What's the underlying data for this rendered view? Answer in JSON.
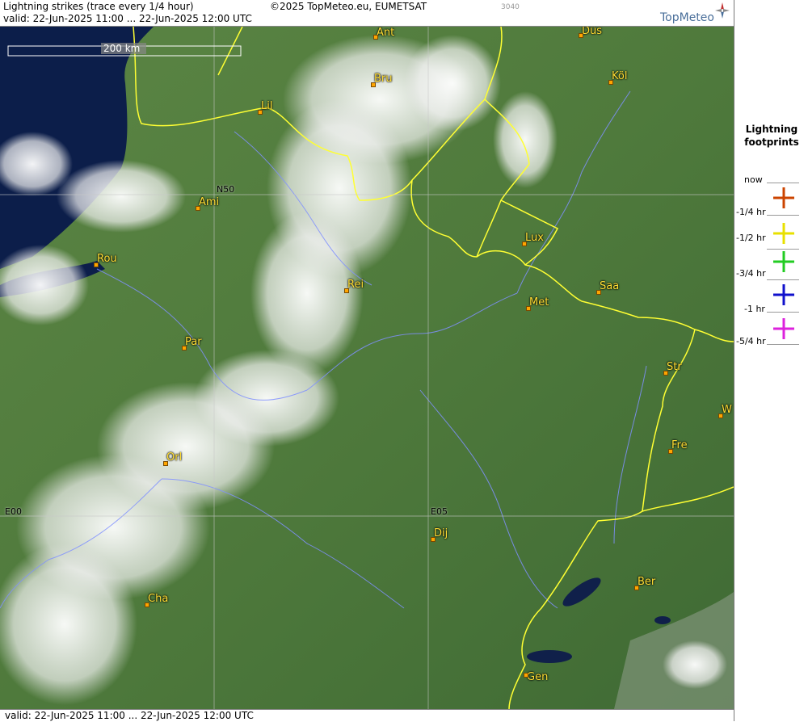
{
  "header": {
    "title": "Lightning strikes (trace every 1/4 hour)",
    "copyright": "©2025 TopMeteo.eu, EUMETSAT",
    "code": "3040",
    "valid": "valid:  22-Jun-2025 11:00 ... 22-Jun-2025 12:00 UTC",
    "brand": "TopMeteo"
  },
  "footer": {
    "valid": "valid:  22-Jun-2025 11:00 ... 22-Jun-2025 12:00 UTC"
  },
  "map": {
    "scale_label": "200 km",
    "grid_labels": [
      "N50",
      "E00",
      "E05"
    ],
    "cities": [
      "Ant",
      "Düs",
      "Bru",
      "Köl",
      "Lil",
      "Ami",
      "Rou",
      "Lux",
      "Rei",
      "Saa",
      "Met",
      "Par",
      "Str",
      "W",
      "Orl",
      "Fre",
      "Dij",
      "Ber",
      "Cha",
      "Gen"
    ]
  },
  "legend": {
    "title_line1": "Lightning",
    "title_line2": "footprints",
    "rows": [
      {
        "label": "now",
        "color": ""
      },
      {
        "label": "-1/4 hr",
        "color": "#cc4400"
      },
      {
        "label": "-1/2 hr",
        "color": "#e8e000"
      },
      {
        "label": "-3/4 hr",
        "color": "#22cc22"
      },
      {
        "label": "-1 hr",
        "color": "#1111cc"
      },
      {
        "label": "-5/4 hr",
        "color": "#dd22dd"
      }
    ]
  },
  "colors": {
    "border": "#ffff33",
    "river": "#8090ff",
    "land": "#4e7a3a",
    "sea": "#0c1e4a",
    "city_label": "#ffdd33"
  }
}
